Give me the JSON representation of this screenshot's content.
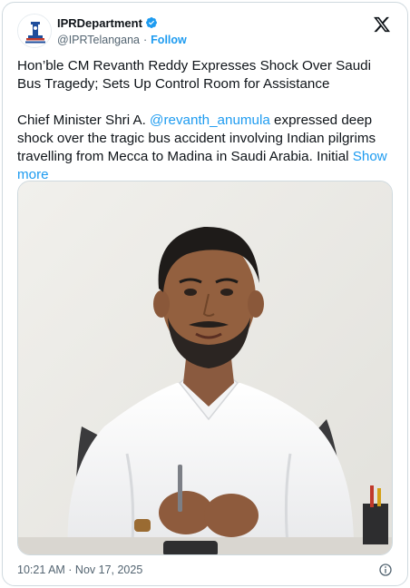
{
  "account": {
    "display_name": "IPRDepartment",
    "handle": "@IPRTelangana",
    "separator": "·",
    "follow_label": "Follow",
    "avatar_icon": "telangana-emblem-icon",
    "verified_icon": "verified-badge-icon",
    "verified_color": "#1d9bf0"
  },
  "platform_icon": "x-logo-icon",
  "post": {
    "headline": "Hon’ble CM Revanth Reddy Expresses Shock Over Saudi Bus Tragedy; Sets Up Control Room for Assistance",
    "body_prefix": "Chief Minister Shri A. ",
    "mention": "@revanth_anumula",
    "body_suffix": " expressed deep shock over the tragic bus accident involving Indian pilgrims travelling from Mecca to Madina in Saudi Arabia. Initial ",
    "show_more_label": "Show more"
  },
  "media": {
    "type": "photo",
    "subject": "photo-of-man-in-white-shirt-at-desk"
  },
  "footer": {
    "timestamp": "10:21 AM · Nov 17, 2025",
    "info_icon": "info-icon"
  },
  "colors": {
    "accent": "#1d9bf0",
    "text": "#0f1419",
    "secondary": "#536471",
    "border": "#cfd9de"
  }
}
